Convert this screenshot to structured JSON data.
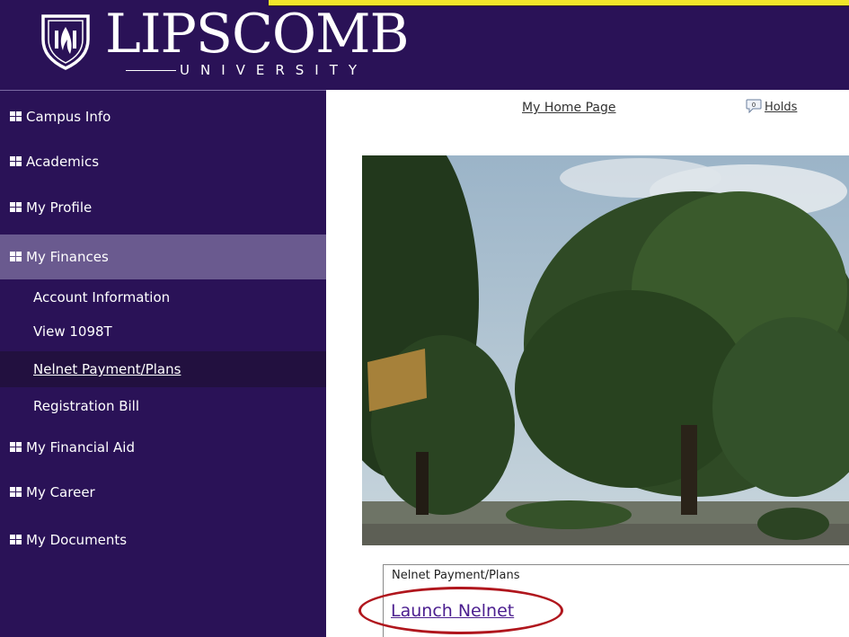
{
  "header": {
    "logo_word": "LIPSCOMB",
    "logo_sub": "UNIVERSITY",
    "brand_color": "#2a1257",
    "highlight_color": "#f2e62a"
  },
  "sidebar": {
    "items": [
      {
        "label": "Campus Info",
        "icon": "grid-icon"
      },
      {
        "label": "Academics",
        "icon": "grid-icon"
      },
      {
        "label": "My Profile",
        "icon": "grid-icon"
      },
      {
        "label": "My Finances",
        "icon": "grid-icon",
        "active": true
      },
      {
        "label": "My Financial Aid",
        "icon": "grid-icon"
      },
      {
        "label": "My Career",
        "icon": "grid-icon"
      },
      {
        "label": "My Documents",
        "icon": "grid-icon"
      }
    ],
    "finances_subitems": [
      {
        "label": "Account Information"
      },
      {
        "label": "View 1098T"
      },
      {
        "label": "Nelnet Payment/Plans",
        "current": true
      },
      {
        "label": "Registration Bill"
      }
    ],
    "active_color": "#6a5a8f"
  },
  "main": {
    "top_links": {
      "home": "My Home Page",
      "holds": "Holds",
      "holds_count": "0"
    },
    "panel": {
      "title": "Nelnet Payment/Plans",
      "link": "Launch Nelnet",
      "link_color": "#4b1e8f"
    },
    "annotation_color": "#b0161d"
  }
}
